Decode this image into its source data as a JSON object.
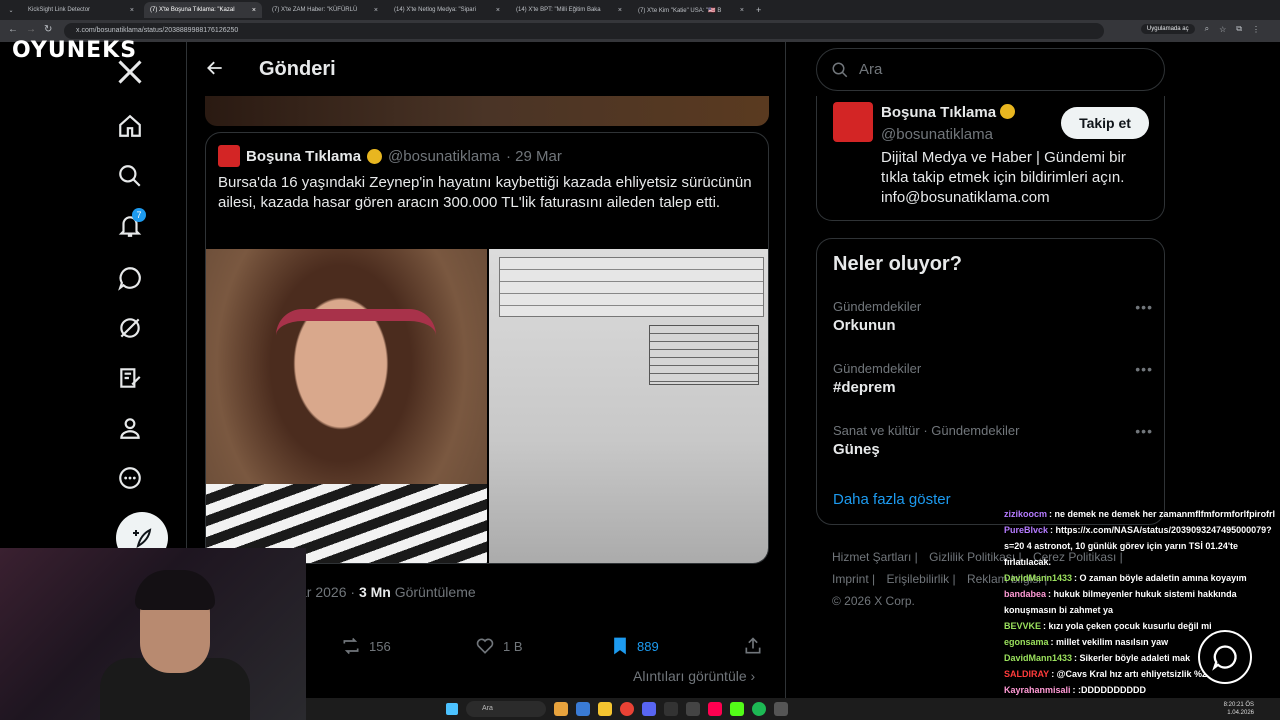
{
  "browser": {
    "tabs": [
      {
        "label": "KickSight Link Detector",
        "active": false
      },
      {
        "label": "(7) X'te Boşuna Tıklama: \"Kazal",
        "active": true
      },
      {
        "label": "(7) X'te ZAM Haber: \"KÜFÜRLÜ",
        "active": false
      },
      {
        "label": "(14) X'te Netlog Medya: \"Sipari",
        "active": false
      },
      {
        "label": "(14) X'te BPT: \"Milli Eğitim Baka",
        "active": false
      },
      {
        "label": "(7) X'te Kim \"Katie\" USA: \"🇺🇸 B",
        "active": false
      }
    ],
    "url": "x.com/bosunatiklama/status/2038889988176126250",
    "app_button": "Uygulamada aç"
  },
  "stream_logo": "OYUNEKS",
  "nav": {
    "notification_count": "7"
  },
  "header": {
    "title": "Gönderi"
  },
  "quote": {
    "name": "Boşuna Tıklama",
    "handle": "@bosunatiklama",
    "date": "· 29 Mar",
    "text": "Bursa'da 16 yaşındaki Zeynep'in hayatını kaybettiği kazada ehliyetsiz sürücünün ailesi, kazada hasar gören aracın 300.000 TL'lik faturasını aileden talep etti."
  },
  "meta": {
    "date": "ar 2026 ·",
    "views": "3 Mn",
    "views_label": "Görüntüleme"
  },
  "actions": {
    "retweets": "156",
    "likes": "1 B",
    "bookmarks": "889",
    "quotes_link": "Alıntıları görüntüle"
  },
  "search": {
    "placeholder": "Ara"
  },
  "profile_card": {
    "name": "Boşuna Tıklama",
    "handle": "@bosunatiklama",
    "follow": "Takip et",
    "bio": "Dijital Medya ve Haber | Gündemi bir tıkla takip etmek için bildirimleri açın. info@bosunatiklama.com"
  },
  "trends": {
    "title": "Neler oluyor?",
    "items": [
      {
        "category": "Gündemdekiler",
        "topic": "Orkunun"
      },
      {
        "category": "Gündemdekiler",
        "topic": "#deprem"
      },
      {
        "category": "Sanat ve kültür · Gündemdekiler",
        "topic": "Güneş"
      }
    ],
    "show_more": "Daha fazla göster"
  },
  "footer": {
    "links": [
      "Hizmet Şartları |",
      "Gizlilik Politikası |",
      "Çerez Politikası |",
      "Imprint |",
      "Erişilebilirlik |",
      "Reklam bilgisi |"
    ],
    "copyright": "© 2026 X Corp."
  },
  "chat": [
    {
      "user": "zizikoocm",
      "color": "#b57bff",
      "msg": ": ne demek ne demek her zamanmflfmformforlfpirofrl"
    },
    {
      "user": "PureBlvck",
      "color": "#b57bff",
      "msg": ": https://x.com/NASA/status/2039093247495000079?s=20 4 astronot, 10 günlük görev için yarın TSİ 01.24'te fırlatılacak."
    },
    {
      "user": "DavidMann1433",
      "color": "#9be15d",
      "msg": ": O zaman böyle adaletin amına koyayım"
    },
    {
      "user": "bandabea",
      "color": "#ff9ad5",
      "msg": ": hukuk bilmeyenler hukuk sistemi hakkında konuşmasın bi zahmet ya"
    },
    {
      "user": "BEVVKE",
      "color": "#9be15d",
      "msg": ": kızı yola çeken çocuk kusurlu değil mi"
    },
    {
      "user": "egonsama",
      "color": "#9be15d",
      "msg": ": millet vekilim nasılsın yaw"
    },
    {
      "user": "DavidMann1433",
      "color": "#9be15d",
      "msg": ": Sikerler böyle adaleti mak"
    },
    {
      "user": "SALDIRAY",
      "color": "#ff3b3b",
      "msg": ": @Cavs Kral hız artı ehliyetsizlik %25 mi?"
    },
    {
      "user": "Kayrahanmisali",
      "color": "#ff9ad5",
      "msg": ": :DDDDDDDDDD"
    }
  ],
  "taskbar": {
    "search": "Ara",
    "time": "8:20:21 ÖS",
    "date": "1.04.2026"
  },
  "colors": {
    "accent": "#1d9bf0",
    "bookmark": "#1d9bf0",
    "bg": "#000000"
  }
}
